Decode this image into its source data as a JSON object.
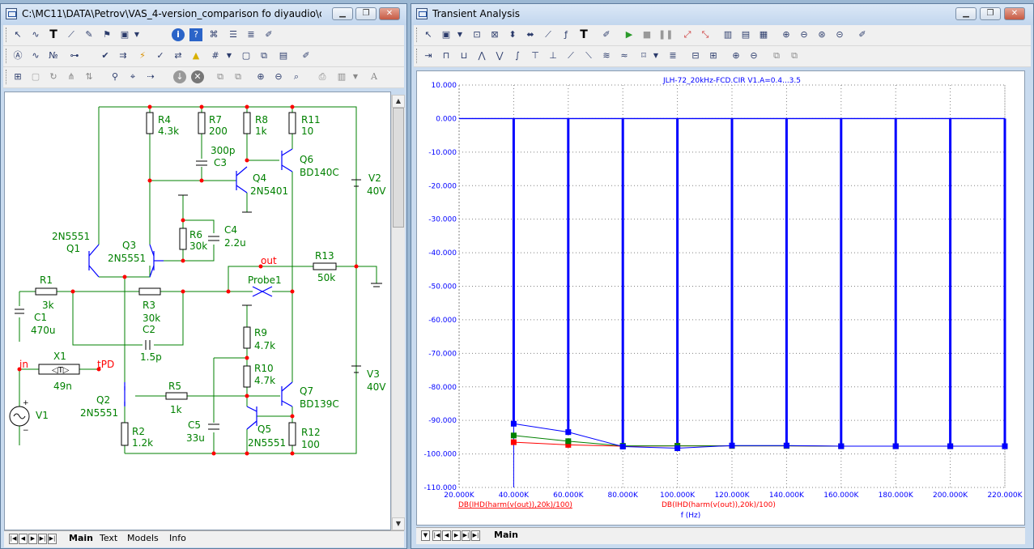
{
  "schematic_window": {
    "title": "C:\\MC11\\DATA\\Petrov\\VAS_4-version_comparison fo diyaudio\\comp...",
    "tabs": [
      "Main",
      "Text",
      "Models",
      "Info"
    ],
    "components": {
      "R4": {
        "name": "R4",
        "value": "4.3k"
      },
      "R7": {
        "name": "R7",
        "value": "200"
      },
      "R8": {
        "name": "R8",
        "value": "1k"
      },
      "R11": {
        "name": "R11",
        "value": "10"
      },
      "C3": {
        "name": "C3",
        "value": "300p"
      },
      "Q4": {
        "name": "Q4",
        "value": "2N5401"
      },
      "Q6": {
        "name": "Q6",
        "value": "BD140C"
      },
      "V2": {
        "name": "V2",
        "value": "40V"
      },
      "R6": {
        "name": "R6",
        "value": "30k"
      },
      "C4": {
        "name": "C4",
        "value": "2.2u"
      },
      "Q1": {
        "name": "Q1",
        "value": "2N5551"
      },
      "Q3": {
        "name": "Q3",
        "value": "2N5551"
      },
      "R1": {
        "name": "R1",
        "value": "3k"
      },
      "R13": {
        "name": "R13",
        "value": "50k"
      },
      "C1": {
        "name": "C1",
        "value": "470u"
      },
      "R3": {
        "name": "R3",
        "value": "30k"
      },
      "C2": {
        "name": "C2",
        "value": "1.5p"
      },
      "R9": {
        "name": "R9",
        "value": "4.7k"
      },
      "X1": {
        "name": "X1",
        "value": "49n"
      },
      "R10": {
        "name": "R10",
        "value": "4.7k"
      },
      "V3": {
        "name": "V3",
        "value": "40V"
      },
      "Q7": {
        "name": "Q7",
        "value": "BD139C"
      },
      "Q2": {
        "name": "Q2",
        "value": "2N5551"
      },
      "R5": {
        "name": "R5",
        "value": "1k"
      },
      "V1": {
        "name": "V1"
      },
      "C5": {
        "name": "C5",
        "value": "33u"
      },
      "Q5": {
        "name": "Q5",
        "value": "2N5551"
      },
      "R12": {
        "name": "R12",
        "value": "100"
      },
      "R2": {
        "name": "R2",
        "value": "1.2k"
      }
    },
    "nodes": {
      "out": "out",
      "probe": "Probe1",
      "in": "in",
      "tpd": "tPD"
    }
  },
  "analysis_window": {
    "title": "Transient Analysis",
    "tabs": [
      "Main"
    ]
  },
  "chart_data": {
    "type": "line",
    "title": "JLH-72_20kHz-FCD.CIR V1.A=0.4...3.5",
    "xlabel": "f (Hz)",
    "ylabel": "",
    "series_label_left": "DB(IHD(harm(v(out)),20k)/100)",
    "series_label_right": "DB(IHD(harm(v(out)),20k)/100)",
    "xlim": [
      20000,
      220000
    ],
    "ylim": [
      -110,
      10
    ],
    "x_tick_labels": [
      "20.000K",
      "40.000K",
      "60.000K",
      "80.000K",
      "100.000K",
      "120.000K",
      "140.000K",
      "160.000K",
      "180.000K",
      "200.000K",
      "220.000K"
    ],
    "y_tick_labels": [
      "10.000",
      "0.000",
      "-10.000",
      "-20.000",
      "-30.000",
      "-40.000",
      "-50.000",
      "-60.000",
      "-70.000",
      "-80.000",
      "-90.000",
      "-100.000",
      "-110.000"
    ],
    "grid": true,
    "stem_x": [
      40000,
      60000,
      80000,
      100000,
      120000,
      140000,
      160000,
      180000,
      200000,
      220000
    ],
    "stem_top": 0,
    "series": [
      {
        "color": "#0000ff",
        "x": [
          40000,
          60000,
          80000,
          100000,
          120000,
          140000,
          160000,
          180000,
          200000,
          220000
        ],
        "values": [
          -91,
          -93.5,
          -97.8,
          -98.3,
          -97.5,
          -97.5,
          -97.7,
          -97.7,
          -97.7,
          -97.7
        ]
      },
      {
        "color": "#008000",
        "x": [
          40000,
          60000,
          80000,
          100000,
          120000,
          140000,
          160000,
          180000,
          200000,
          220000
        ],
        "values": [
          -94.5,
          -96.2,
          -97.6,
          -97.6,
          -97.6,
          -97.6,
          -97.7,
          -97.7,
          -97.7,
          -97.7
        ]
      },
      {
        "color": "#ff0000",
        "x": [
          40000,
          60000,
          80000,
          100000,
          120000,
          140000,
          160000,
          180000,
          200000,
          220000
        ],
        "values": [
          -96.5,
          -97.3,
          -97.7,
          -97.6,
          -97.6,
          -97.6,
          -97.7,
          -97.7,
          -97.7,
          -97.7
        ]
      }
    ],
    "colors": {
      "grid": "#808080",
      "axis_text": "#0000ff",
      "stem": "#0000ff",
      "left_label": "#ff0000",
      "right_label": "#ff0000"
    }
  }
}
